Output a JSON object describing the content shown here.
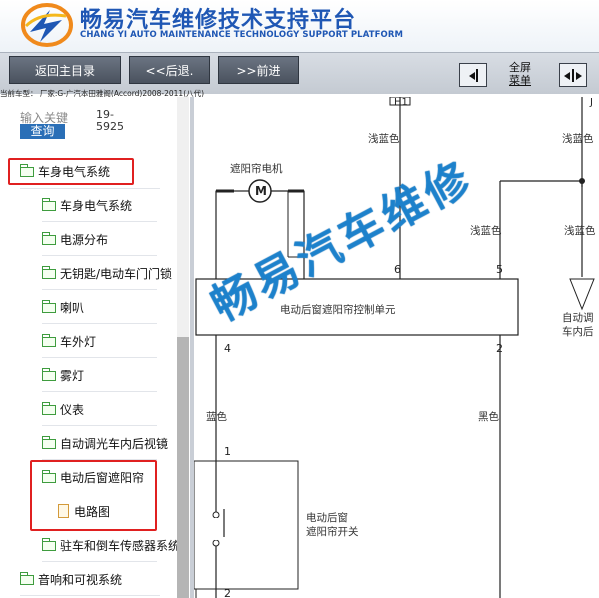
{
  "header": {
    "title_cn": "畅易汽车维修技术支持平台",
    "title_en": "CHANG YI AUTO MAINTENANCE TECHNOLOGY SUPPORT PLATFORM"
  },
  "toolbar": {
    "home_label": "返回主目录",
    "back_label": "<<后退.",
    "forward_label": ">>前进",
    "fullscreen_line1": "全屏",
    "fullscreen_line2": "菜单"
  },
  "vehicle_info": "当前车型：  厂家:G-广汽本田雅阁(Accord)2008-2011(八代)",
  "search": {
    "placeholder": "输入关键",
    "button_label": "查询",
    "code_line1": "19-",
    "code_line2": "5925"
  },
  "tree": [
    {
      "label": "车身电气系统",
      "icon": "folder-icon",
      "highlighted": true
    },
    {
      "label": "车身电气系统",
      "icon": "folder-icon"
    },
    {
      "label": "电源分布",
      "icon": "folder-icon"
    },
    {
      "label": "无钥匙/电动车门门锁",
      "icon": "folder-icon"
    },
    {
      "label": "喇叭",
      "icon": "folder-icon"
    },
    {
      "label": "车外灯",
      "icon": "folder-icon"
    },
    {
      "label": "雾灯",
      "icon": "folder-icon"
    },
    {
      "label": "仪表",
      "icon": "folder-icon"
    },
    {
      "label": "自动调光车内后视镜",
      "icon": "folder-icon"
    },
    {
      "label": "电动后窗遮阳帘",
      "icon": "folder-icon",
      "highlighted": true
    },
    {
      "label": "电路图",
      "icon": "file-icon",
      "highlighted": true
    },
    {
      "label": "驻车和倒车传感器系统",
      "icon": "folder-icon"
    },
    {
      "label": "音响和可视系统",
      "icon": "folder-icon"
    }
  ],
  "diagram": {
    "connector_h1": "H1",
    "connector_j": "J",
    "motor_label": "遮阳帘电机",
    "motor_symbol": "M",
    "wire_light_blue_1": "浅蓝色",
    "wire_light_blue_2": "浅蓝色",
    "wire_light_blue_3": "浅蓝色",
    "wire_light_blue_top": "浅蓝色",
    "control_unit": "电动后窗遮阳帘控制单元",
    "pin_6": "6",
    "pin_5": "5",
    "pin_4": "4",
    "pin_2": "2",
    "pin_1": "1",
    "pin_2b": "2",
    "wire_blue": "蓝色",
    "wire_black": "黑色",
    "switch_line1": "电动后窗",
    "switch_line2": "遮阳帘开关",
    "auto_line1": "自动调",
    "auto_line2": "车内后",
    "watermark": "畅易汽车维修"
  },
  "colors": {
    "brand_blue": "#1f57b4",
    "highlight_red": "#e02020",
    "folder_green": "#3e9c3e",
    "watermark_blue": "#238cd7"
  }
}
